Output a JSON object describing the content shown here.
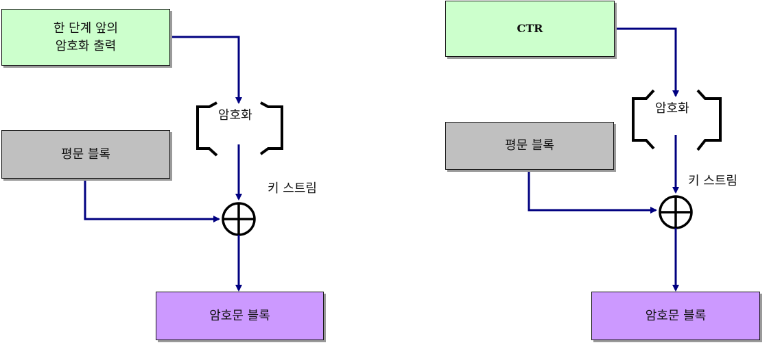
{
  "left": {
    "prev_output": "한 단계 앞의\n암호화 출력",
    "encrypt": "암호화",
    "plaintext": "평문 블록",
    "keystream": "키 스트림",
    "ciphertext": "암호문 블록"
  },
  "right": {
    "counter": "CTR",
    "encrypt": "암호화",
    "plaintext": "평문 블록",
    "keystream": "키 스트림",
    "ciphertext": "암호문 블록"
  },
  "colors": {
    "arrow": "#000080",
    "input_box": "#ccffcc",
    "plaintext_box": "#c0c0c0",
    "ciphertext_box": "#cc99ff"
  }
}
